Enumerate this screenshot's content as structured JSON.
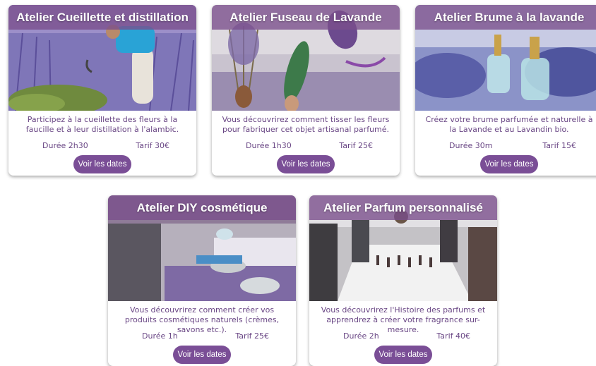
{
  "workshops": [
    {
      "title": "Atelier Cueillette et distillation",
      "description": "Participez à la cueillette des fleurs à la faucille et à leur distillation à l'alambic.",
      "duration": "Durée 2h30",
      "price": "Tarif 30€",
      "button_label": "Voir les dates"
    },
    {
      "title": "Atelier Fuseau de Lavande",
      "description": "Vous découvrirez comment tisser les fleurs pour fabriquer cet objet artisanal parfumé.",
      "duration": "Durée 1h30",
      "price": "Tarif 25€",
      "button_label": "Voir les dates"
    },
    {
      "title": "Atelier Brume à la lavande",
      "description": "Créez votre brume parfumée et naturelle à la Lavande et au Lavandin bio.",
      "duration": "Durée 30m",
      "price": "Tarif 15€",
      "button_label": "Voir les dates"
    },
    {
      "title": "Atelier DIY cosmétique",
      "description": "Vous découvrirez comment créer vos produits cosmétiques naturels (crèmes, savons etc.).",
      "duration": "Durée 1h",
      "price": "Tarif 25€",
      "button_label": "Voir les dates"
    },
    {
      "title": "Atelier Parfum personnalisé",
      "description": "Vous découvrirez l'Histoire des parfums et apprendrez à créer votre fragrance sur-mesure.",
      "duration": "Durée 2h",
      "price": "Tarif 40€",
      "button_label": "Voir les dates"
    }
  ],
  "colors": {
    "accent": "#7a4e96",
    "title_overlay": "#7a4e8c",
    "text": "#6a4785"
  }
}
